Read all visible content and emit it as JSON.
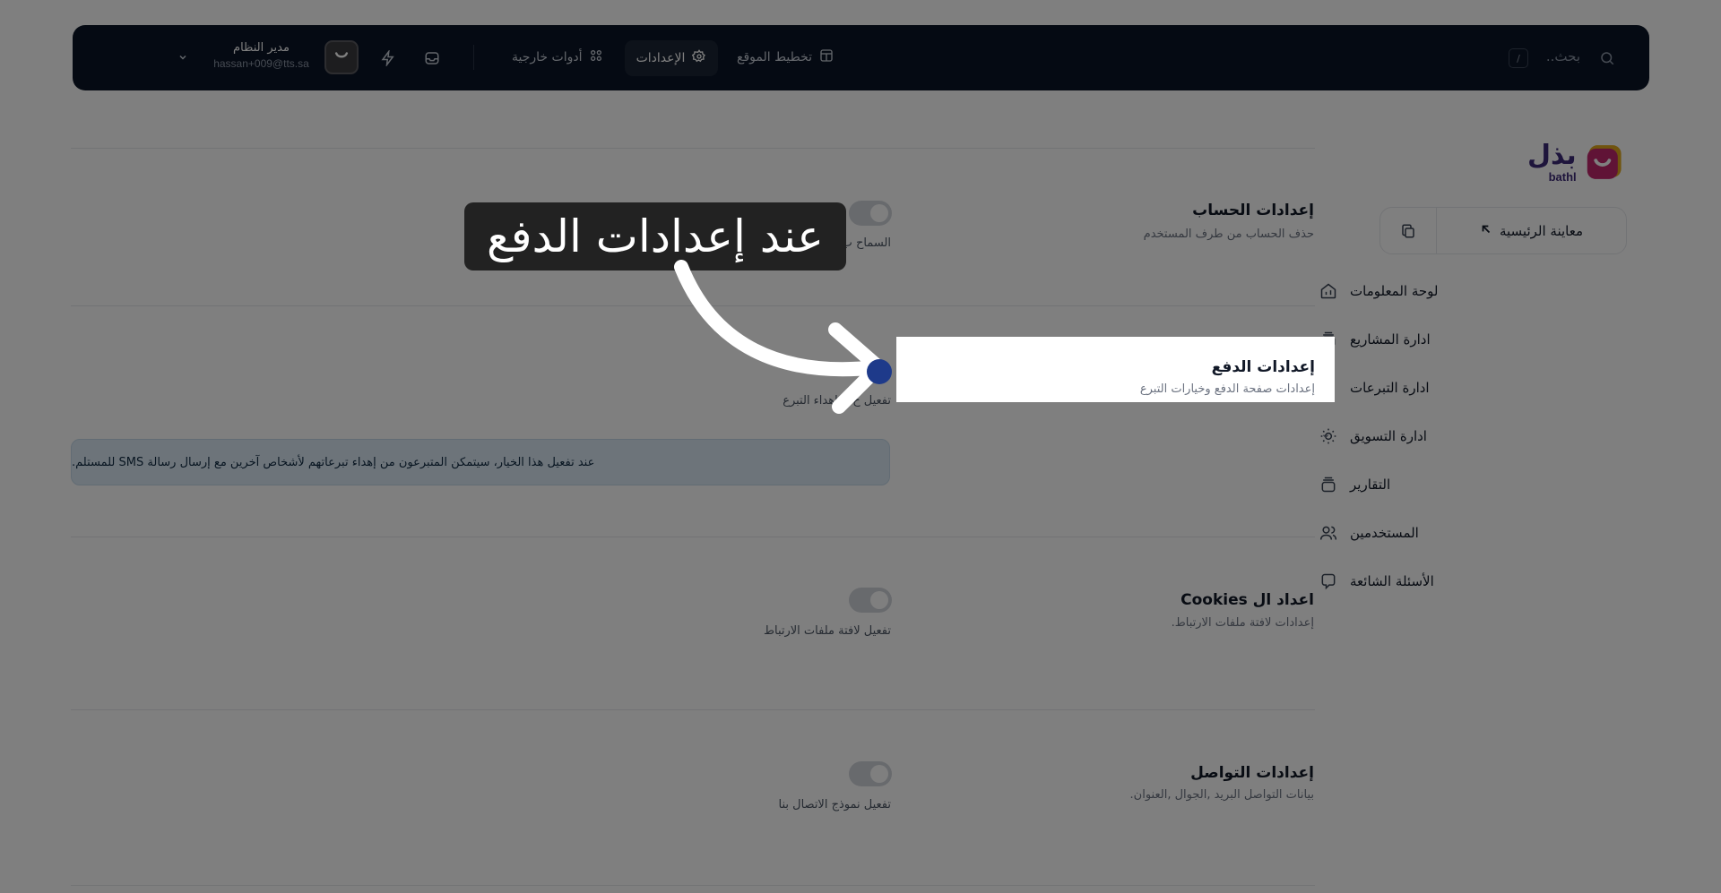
{
  "topbar": {
    "search_placeholder": "بحث..",
    "search_shortcut": "/",
    "nav": [
      {
        "label": "تخطيط الموقع",
        "icon": "layout-icon"
      },
      {
        "label": "الإعدادات",
        "icon": "gear-icon",
        "active": true
      },
      {
        "label": "أدوات خارجية",
        "icon": "apps-icon"
      }
    ],
    "actions": [
      "inbox-icon",
      "bolt-icon"
    ],
    "user": {
      "name": "مدير النظام",
      "email": "hassan+009@tts.sa",
      "avatar_icon": "smile-icon"
    }
  },
  "sidebar": {
    "logo": {
      "ar": "بذل",
      "en": "bathl"
    },
    "preview": {
      "label": "معاينة الرئيسية",
      "icon": "arrow-up-left-icon",
      "copy_icon": "copy-icon"
    },
    "items": [
      {
        "label": "لوحة المعلومات",
        "icon": "home-icon",
        "has_children": false
      },
      {
        "label": "ادارة المشاريع",
        "icon": "stack-icon",
        "has_children": true
      },
      {
        "label": "ادارة التبرعات",
        "icon": "hand-coin-icon",
        "has_children": true
      },
      {
        "label": "ادارة التسويق",
        "icon": "sun-icon",
        "has_children": true
      },
      {
        "label": "التقارير",
        "icon": "stack-icon",
        "has_children": false
      },
      {
        "label": "المستخدمين",
        "icon": "users-icon",
        "has_children": false
      },
      {
        "label": "الأسئلة الشائعة",
        "icon": "faq-icon",
        "has_children": false
      }
    ]
  },
  "settings": {
    "account": {
      "title": "إعدادات الحساب",
      "desc": "حذف الحساب من طرف المستخدم",
      "toggle_label": "السماح ب",
      "enabled": false
    },
    "payment": {
      "title": "إعدادات الدفع",
      "desc": "إعدادات صفحة الدفع وخيارات التبرع",
      "toggle_label": "تفعيل خ... اهداء التبرع",
      "enabled": true
    },
    "payment_info": "عند تفعيل هذا الخيار، سيتمكن المتبرعون من إهداء تبرعاتهم لأشخاص آخرين مع إرسال رسالة SMS للمستلم.",
    "cookies": {
      "title": "اعداد ال Cookies",
      "desc": "إعدادات لافتة ملفات الارتباط.",
      "toggle_label": "تفعيل لافتة ملفات الارتباط",
      "enabled": false
    },
    "contact": {
      "title": "إعدادات التواصل",
      "desc": "بيانات التواصل البريد ,الجوال ,العنوان.",
      "toggle_label": "تفعيل نموذج الاتصال بنا",
      "enabled": false
    }
  },
  "overlay": {
    "caption": "عند إعدادات الدفع"
  },
  "colors": {
    "topbar": "#0b1526",
    "primary": "#1e3a8a",
    "info_bg": "#dbe9f4",
    "logo": "#3d2a78",
    "logo_accent": "#e0a81c"
  }
}
